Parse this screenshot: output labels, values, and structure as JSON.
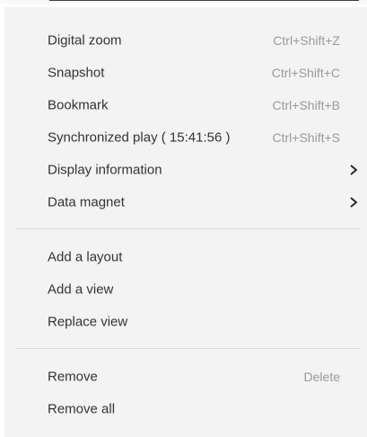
{
  "context_menu": {
    "groups": [
      [
        {
          "label": "Digital zoom",
          "shortcut": "Ctrl+Shift+Z"
        },
        {
          "label": "Snapshot",
          "shortcut": "Ctrl+Shift+C"
        },
        {
          "label": "Bookmark",
          "shortcut": "Ctrl+Shift+B"
        },
        {
          "label": "Synchronized play ( 15:41:56 )",
          "shortcut": "Ctrl+Shift+S"
        },
        {
          "label": "Display information",
          "submenu_icon": "chevron-right-icon"
        },
        {
          "label": "Data magnet",
          "submenu_icon": "chevron-right-icon"
        }
      ],
      [
        {
          "label": "Add a layout"
        },
        {
          "label": "Add a view"
        },
        {
          "label": "Replace view"
        }
      ],
      [
        {
          "label": "Remove",
          "shortcut": "Delete"
        },
        {
          "label": "Remove all"
        }
      ]
    ]
  }
}
